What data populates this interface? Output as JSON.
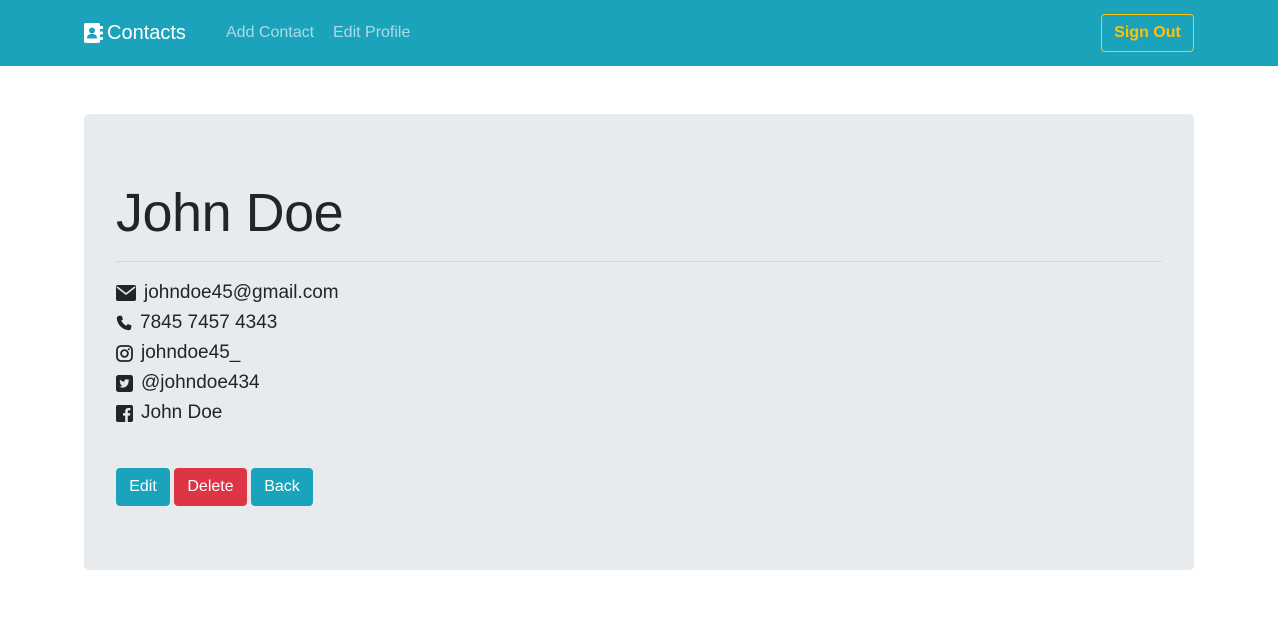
{
  "navbar": {
    "brand": "Contacts",
    "links": [
      "Add Contact",
      "Edit Profile"
    ],
    "sign_out": "Sign Out",
    "brand_icon": "address-book-icon"
  },
  "contact": {
    "name": "John Doe",
    "email": "johndoe45@gmail.com",
    "phone": "7845 7457 4343",
    "instagram": "johndoe45_",
    "twitter": "@johndoe434",
    "facebook": "John Doe"
  },
  "actions": {
    "edit": "Edit",
    "delete": "Delete",
    "back": "Back"
  },
  "colors": {
    "navbar": "#1ba3bb",
    "card": "#e7ebee",
    "sign_out": "#ffc107",
    "primary_button": "#1ba3bb",
    "danger_button": "#dc3545"
  }
}
